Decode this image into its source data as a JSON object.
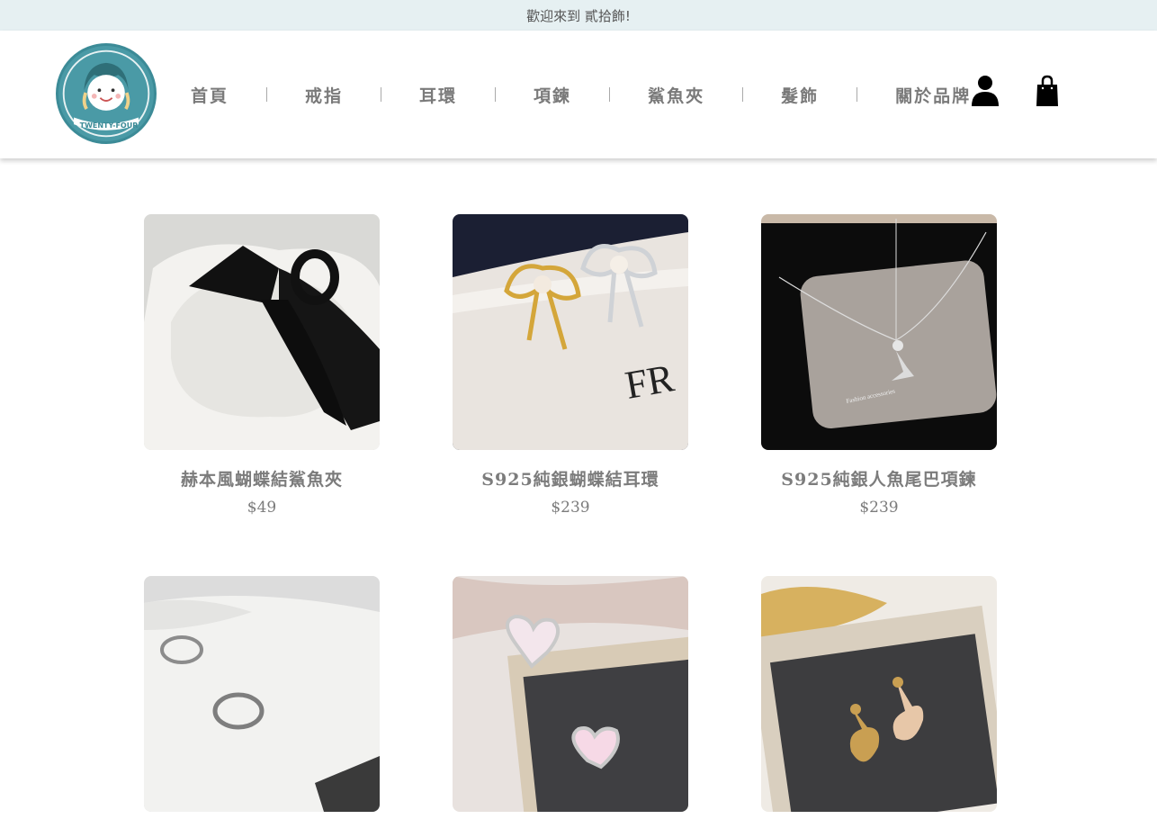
{
  "announcement": "歡迎來到 貳拾飾!",
  "logo": {
    "text": "TWENTY-FOUR"
  },
  "nav": {
    "items": [
      {
        "label": "首頁"
      },
      {
        "label": "戒指"
      },
      {
        "label": "耳環"
      },
      {
        "label": "項鍊"
      },
      {
        "label": "鯊魚夾"
      },
      {
        "label": "髮飾"
      },
      {
        "label": "關於品牌"
      }
    ]
  },
  "header_icons": {
    "account": "user-icon",
    "cart": "shopping-bag-icon"
  },
  "products": [
    {
      "name": "赫本風蝴蝶結鯊魚夾",
      "price": "$49"
    },
    {
      "name": "S925純銀蝴蝶結耳環",
      "price": "$239"
    },
    {
      "name": "S925純銀人魚尾巴項鍊",
      "price": "$239"
    },
    {
      "name": "",
      "price": ""
    },
    {
      "name": "",
      "price": ""
    },
    {
      "name": "",
      "price": ""
    }
  ],
  "colors": {
    "announce_bg": "#e6f0f2",
    "logo_teal": "#4a9aa6",
    "text_gray": "#7a7a7a"
  }
}
